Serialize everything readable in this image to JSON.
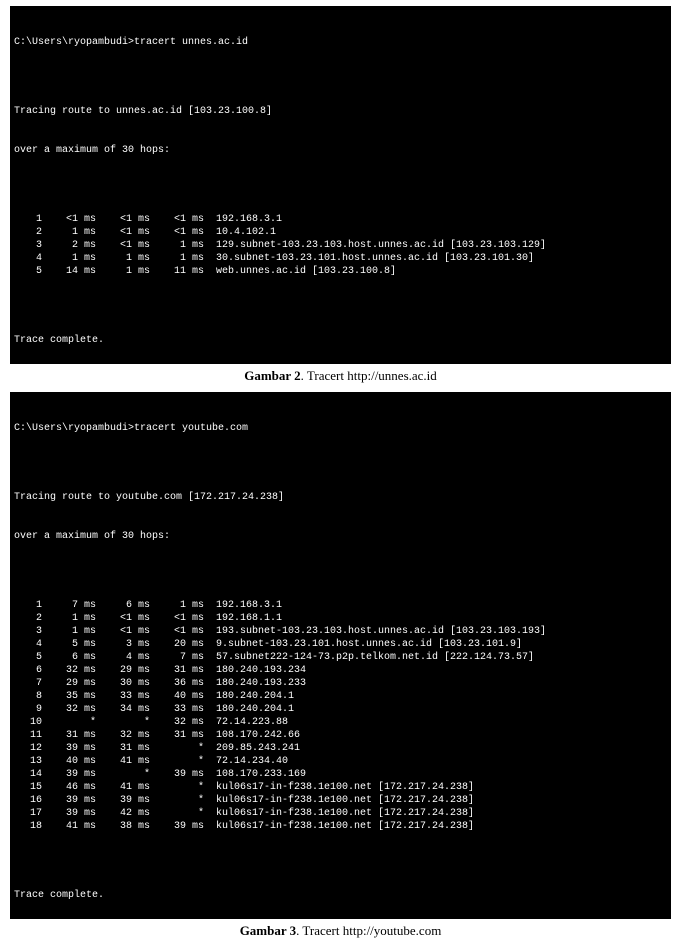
{
  "term1": {
    "prompt_line": "C:\\Users\\ryopambudi>tracert unnes.ac.id",
    "intro1": "Tracing route to unnes.ac.id [103.23.100.8]",
    "intro2": "over a maximum of 30 hops:",
    "hops": [
      {
        "n": "1",
        "t1": "<1 ms",
        "t2": "<1 ms",
        "t3": "<1 ms",
        "host": "192.168.3.1"
      },
      {
        "n": "2",
        "t1": "1 ms",
        "t2": "<1 ms",
        "t3": "<1 ms",
        "host": "10.4.102.1"
      },
      {
        "n": "3",
        "t1": "2 ms",
        "t2": "<1 ms",
        "t3": "1 ms",
        "host": "129.subnet-103.23.103.host.unnes.ac.id [103.23.103.129]"
      },
      {
        "n": "4",
        "t1": "1 ms",
        "t2": "1 ms",
        "t3": "1 ms",
        "host": "30.subnet-103.23.101.host.unnes.ac.id [103.23.101.30]"
      },
      {
        "n": "5",
        "t1": "14 ms",
        "t2": "1 ms",
        "t3": "11 ms",
        "host": "web.unnes.ac.id [103.23.100.8]"
      }
    ],
    "complete": "Trace complete."
  },
  "caption1": {
    "bold": "Gambar 2",
    "rest": ". Tracert http://unnes.ac.id"
  },
  "term2": {
    "prompt_line": "C:\\Users\\ryopambudi>tracert youtube.com",
    "intro1": "Tracing route to youtube.com [172.217.24.238]",
    "intro2": "over a maximum of 30 hops:",
    "hops": [
      {
        "n": "1",
        "t1": "7 ms",
        "t2": "6 ms",
        "t3": "1 ms",
        "host": "192.168.3.1"
      },
      {
        "n": "2",
        "t1": "1 ms",
        "t2": "<1 ms",
        "t3": "<1 ms",
        "host": "192.168.1.1"
      },
      {
        "n": "3",
        "t1": "1 ms",
        "t2": "<1 ms",
        "t3": "<1 ms",
        "host": "193.subnet-103.23.103.host.unnes.ac.id [103.23.103.193]"
      },
      {
        "n": "4",
        "t1": "5 ms",
        "t2": "3 ms",
        "t3": "20 ms",
        "host": "9.subnet-103.23.101.host.unnes.ac.id [103.23.101.9]"
      },
      {
        "n": "5",
        "t1": "6 ms",
        "t2": "4 ms",
        "t3": "7 ms",
        "host": "57.subnet222-124-73.p2p.telkom.net.id [222.124.73.57]"
      },
      {
        "n": "6",
        "t1": "32 ms",
        "t2": "29 ms",
        "t3": "31 ms",
        "host": "180.240.193.234"
      },
      {
        "n": "7",
        "t1": "29 ms",
        "t2": "30 ms",
        "t3": "36 ms",
        "host": "180.240.193.233"
      },
      {
        "n": "8",
        "t1": "35 ms",
        "t2": "33 ms",
        "t3": "40 ms",
        "host": "180.240.204.1"
      },
      {
        "n": "9",
        "t1": "32 ms",
        "t2": "34 ms",
        "t3": "33 ms",
        "host": "180.240.204.1"
      },
      {
        "n": "10",
        "t1": "*",
        "t2": "*",
        "t3": "32 ms",
        "host": "72.14.223.88"
      },
      {
        "n": "11",
        "t1": "31 ms",
        "t2": "32 ms",
        "t3": "31 ms",
        "host": "108.170.242.66"
      },
      {
        "n": "12",
        "t1": "39 ms",
        "t2": "31 ms",
        "t3": "*",
        "host": "209.85.243.241"
      },
      {
        "n": "13",
        "t1": "40 ms",
        "t2": "41 ms",
        "t3": "*",
        "host": "72.14.234.40"
      },
      {
        "n": "14",
        "t1": "39 ms",
        "t2": "*",
        "t3": "39 ms",
        "host": "108.170.233.169"
      },
      {
        "n": "15",
        "t1": "46 ms",
        "t2": "41 ms",
        "t3": "*",
        "host": "kul06s17-in-f238.1e100.net [172.217.24.238]"
      },
      {
        "n": "16",
        "t1": "39 ms",
        "t2": "39 ms",
        "t3": "*",
        "host": "kul06s17-in-f238.1e100.net [172.217.24.238]"
      },
      {
        "n": "17",
        "t1": "39 ms",
        "t2": "42 ms",
        "t3": "*",
        "host": "kul06s17-in-f238.1e100.net [172.217.24.238]"
      },
      {
        "n": "18",
        "t1": "41 ms",
        "t2": "38 ms",
        "t3": "39 ms",
        "host": "kul06s17-in-f238.1e100.net [172.217.24.238]"
      }
    ],
    "complete": "Trace complete."
  },
  "caption2": {
    "bold": "Gambar 3",
    "rest": ". Tracert http://youtube.com"
  }
}
